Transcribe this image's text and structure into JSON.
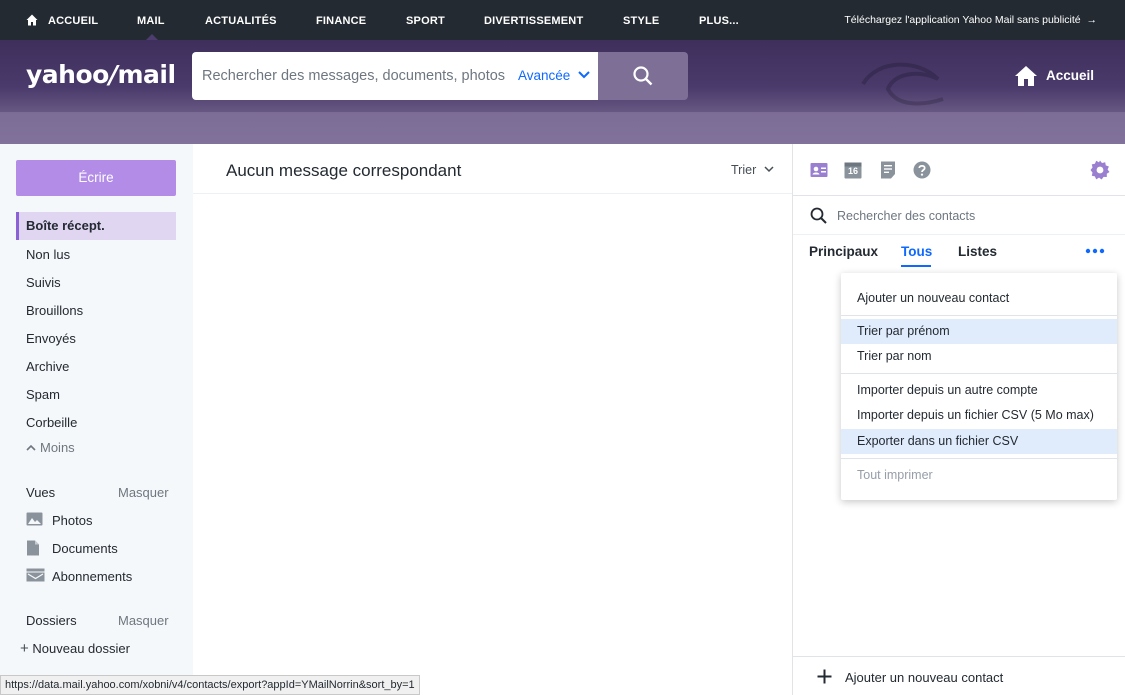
{
  "topnav": {
    "items": [
      "ACCUEIL",
      "MAIL",
      "ACTUALITÉS",
      "FINANCE",
      "SPORT",
      "DIVERTISSEMENT",
      "STYLE",
      "PLUS..."
    ],
    "active": "MAIL",
    "promo": "Téléchargez l'application Yahoo Mail sans publicité",
    "promo_arrow": "→"
  },
  "header": {
    "logo_a": "yahoo",
    "logo_slash": "/",
    "logo_b": "mail",
    "search_placeholder": "Rechercher des messages, documents, photos",
    "advanced_label": "Avancée",
    "home_label": "Accueil"
  },
  "sidebar": {
    "compose_label": "Écrire",
    "folders": [
      "Boîte récept.",
      "Non lus",
      "Suivis",
      "Brouillons",
      "Envoyés",
      "Archive",
      "Spam",
      "Corbeille"
    ],
    "selected_folder": "Boîte récept.",
    "less_label": "Moins",
    "views_title": "Vues",
    "views_hide": "Masquer",
    "views": [
      {
        "icon": "photo-icon",
        "label": "Photos"
      },
      {
        "icon": "document-icon",
        "label": "Documents"
      },
      {
        "icon": "subscriptions-icon",
        "label": "Abonnements"
      }
    ],
    "folders_title": "Dossiers",
    "folders_hide": "Masquer",
    "new_folder_label": "Nouveau dossier"
  },
  "message_list": {
    "empty_text": "Aucun message correspondant",
    "sort_label": "Trier"
  },
  "contacts_panel": {
    "icons": [
      "contacts-icon",
      "calendar-icon",
      "notepad-icon",
      "help-icon",
      "settings-icon"
    ],
    "calendar_day": "16",
    "search_placeholder": "Rechercher des contacts",
    "tabs": [
      "Principaux",
      "Tous",
      "Listes"
    ],
    "active_tab": "Tous",
    "footer_label": "Ajouter un nouveau contact"
  },
  "menu": {
    "items": [
      {
        "label": "Ajouter un nouveau contact",
        "state": "normal"
      },
      {
        "label": "Trier par prénom",
        "state": "highlighted"
      },
      {
        "label": "Trier par nom",
        "state": "normal"
      },
      {
        "label": "Importer depuis un autre compte",
        "state": "normal"
      },
      {
        "label": "Importer depuis un fichier CSV (5 Mo max)",
        "state": "normal"
      },
      {
        "label": "Exporter dans un fichier CSV",
        "state": "highlighted"
      },
      {
        "label": "Tout imprimer",
        "state": "disabled"
      }
    ]
  },
  "status_bar": {
    "url": "https://data.mail.yahoo.com/xobni/v4/contacts/export?appId=YMailNorrin&sort_by=1"
  },
  "colors": {
    "accent_purple": "#b28ce6",
    "link_blue": "#0f69ff",
    "nav_bg": "#232a31",
    "header_purple": "#4a3a6b"
  }
}
